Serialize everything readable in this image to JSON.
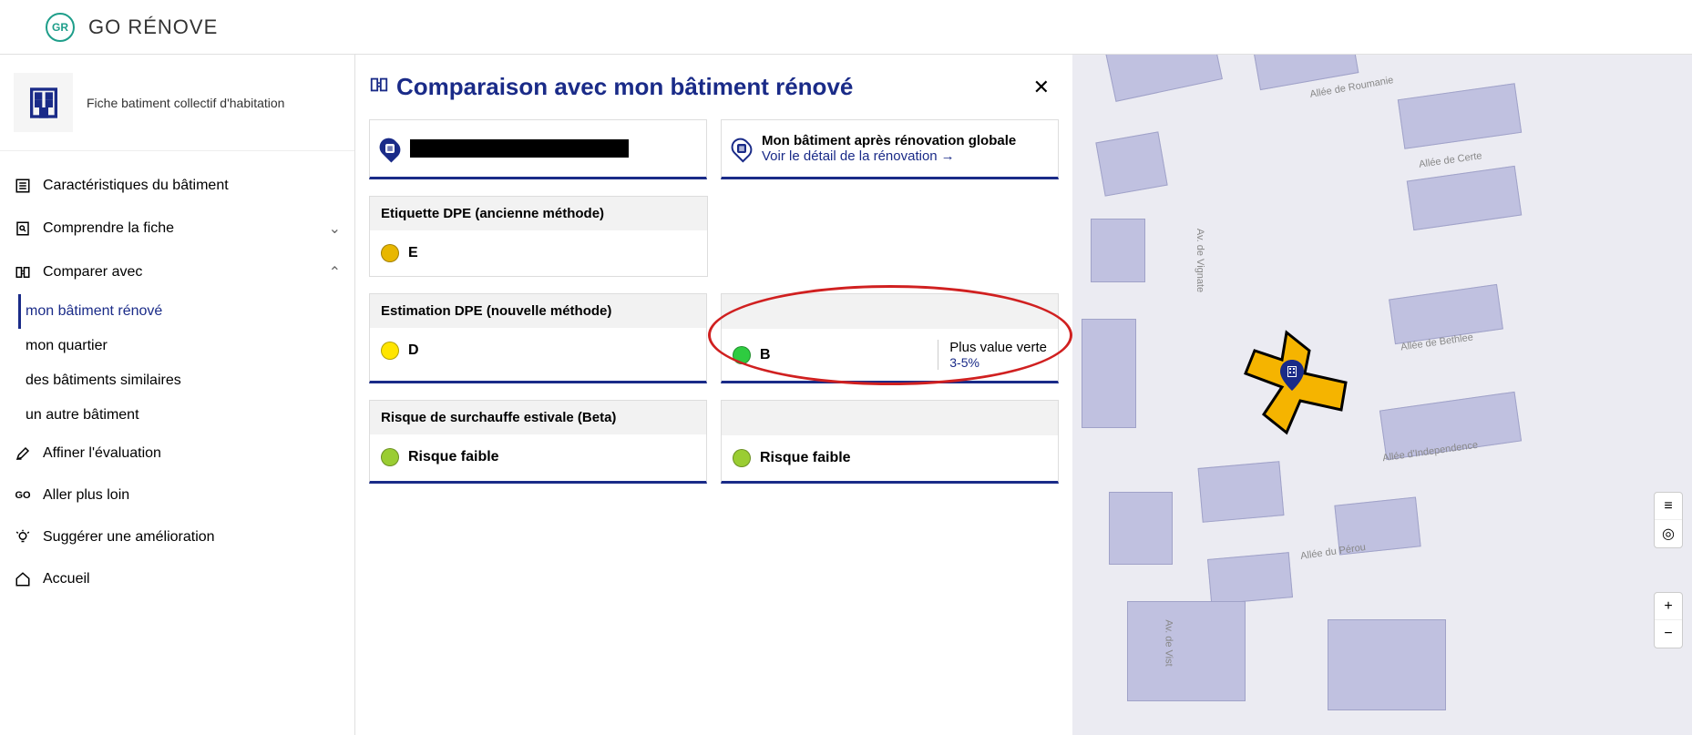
{
  "header": {
    "logo_short": "GR",
    "logo_text": "GO RÉNOVE"
  },
  "sidebar": {
    "subtitle": "Fiche batiment collectif d'habitation",
    "nav": {
      "characteristics": "Caractéristiques du bâtiment",
      "understand": "Comprendre la fiche",
      "compare": "Comparer avec",
      "refine": "Affiner l'évaluation",
      "go_further": "Aller plus loin",
      "suggest": "Suggérer une amélioration",
      "home": "Accueil"
    },
    "compare_items": {
      "renovated": "mon bâtiment rénové",
      "quarter": "mon quartier",
      "similar": "des bâtiments similaires",
      "other": "un autre bâtiment"
    },
    "go_label": "GO"
  },
  "main": {
    "title": "Comparaison avec mon bâtiment rénové",
    "col_right_title": "Mon bâtiment après rénovation globale",
    "col_right_link": "Voir le détail de la rénovation",
    "sections": {
      "dpe_old": "Etiquette DPE (ancienne méthode)",
      "dpe_new": "Estimation DPE (nouvelle méthode)",
      "overheat": "Risque de surchauffe estivale (Beta)"
    },
    "values": {
      "dpe_old_left": "E",
      "dpe_new_left": "D",
      "dpe_new_right": "B",
      "overheat_left": "Risque faible",
      "overheat_right": "Risque faible"
    },
    "plus_value": {
      "title": "Plus value verte",
      "pct": "3-5%"
    }
  },
  "map": {
    "streets": {
      "roumanie": "Allée de Roumanie",
      "certe": "Allée de Certe",
      "vignate": "Av. de Vignate",
      "bethlee": "Allée de Bethlee",
      "independ": "Allée d'Independence",
      "perou": "Allée du Pérou",
      "vist": "Av. de Vist"
    },
    "zoom_in": "+",
    "zoom_out": "−"
  }
}
